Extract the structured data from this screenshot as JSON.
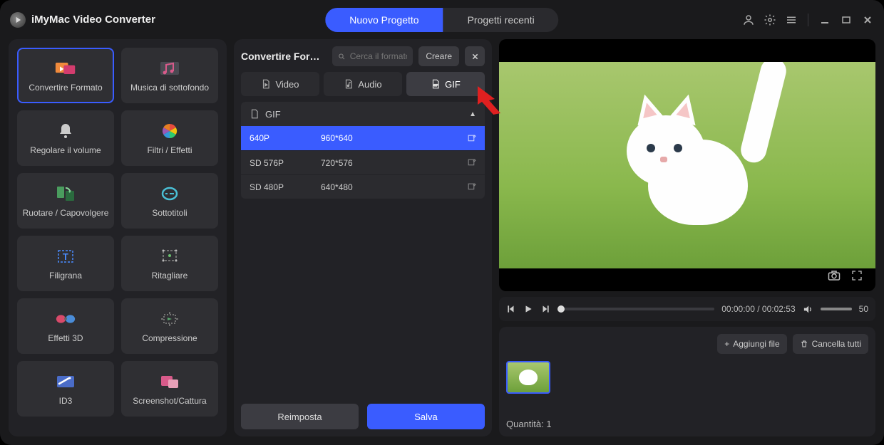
{
  "app": {
    "title": "iMyMac Video Converter"
  },
  "titlebar_tabs": {
    "new_project": "Nuovo Progetto",
    "recent_projects": "Progetti recenti"
  },
  "sidebar": {
    "tools": [
      {
        "id": "convert-format",
        "label": "Convertire Formato",
        "active": true
      },
      {
        "id": "background-music",
        "label": "Musica di sottofondo"
      },
      {
        "id": "adjust-volume",
        "label": "Regolare il volume"
      },
      {
        "id": "filters-effects",
        "label": "Filtri / Effetti"
      },
      {
        "id": "rotate-flip",
        "label": "Ruotare / Capovolgere"
      },
      {
        "id": "subtitles",
        "label": "Sottotitoli"
      },
      {
        "id": "watermark",
        "label": "Filigrana"
      },
      {
        "id": "crop",
        "label": "Ritagliare"
      },
      {
        "id": "effects-3d",
        "label": "Effetti 3D"
      },
      {
        "id": "compression",
        "label": "Compressione"
      },
      {
        "id": "id3",
        "label": "ID3"
      },
      {
        "id": "screenshot",
        "label": "Screenshot/Cattura"
      }
    ]
  },
  "center": {
    "title": "Convertire Forma...",
    "search_placeholder": "Cerca il formato",
    "create_label": "Creare",
    "tabs": {
      "video": "Video",
      "audio": "Audio",
      "gif": "GIF",
      "active": "gif"
    },
    "group_label": "GIF",
    "resolutions": [
      {
        "name": "640P",
        "dim": "960*640",
        "selected": true
      },
      {
        "name": "SD 576P",
        "dim": "720*576"
      },
      {
        "name": "SD 480P",
        "dim": "640*480"
      }
    ],
    "reset_label": "Reimposta",
    "save_label": "Salva"
  },
  "player": {
    "time_current": "00:00:00",
    "time_total": "00:02:53",
    "volume": "50"
  },
  "filepanel": {
    "add_label": "Aggiungi file",
    "clear_label": "Cancella tutti",
    "quantity_label": "Quantità:",
    "quantity_value": "1"
  }
}
